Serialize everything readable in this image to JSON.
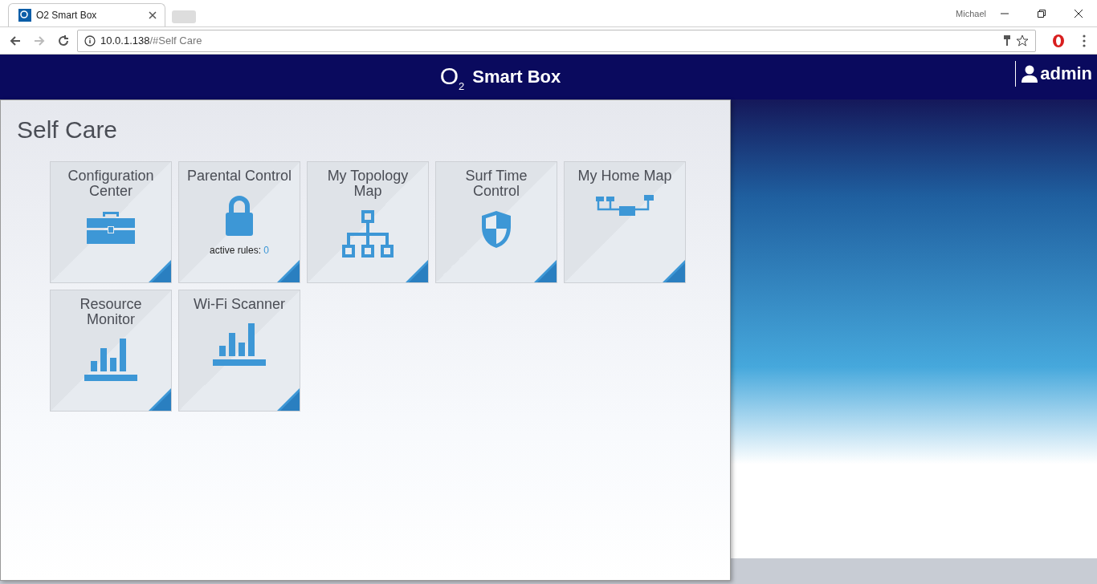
{
  "browser": {
    "tab_title": "O2 Smart Box",
    "profile": "Michael",
    "url_host": "10.0.1.138",
    "url_path": "/#Self Care"
  },
  "header": {
    "logo": "O$_{2}$",
    "title": "Smart Box",
    "user": "admin"
  },
  "page": {
    "title": "Self Care",
    "tiles": [
      {
        "title": "Configuration Center",
        "kind": "toolbox"
      },
      {
        "title": "Parental Control",
        "kind": "lock",
        "note": "active rules:",
        "count": "0"
      },
      {
        "title": "My Topology Map",
        "kind": "topology"
      },
      {
        "title": "Surf Time Control",
        "kind": "shield"
      },
      {
        "title": "My Home Map",
        "kind": "homemap"
      },
      {
        "title": "Resource Monitor",
        "kind": "chart"
      },
      {
        "title": "Wi-Fi Scanner",
        "kind": "chart"
      }
    ]
  }
}
